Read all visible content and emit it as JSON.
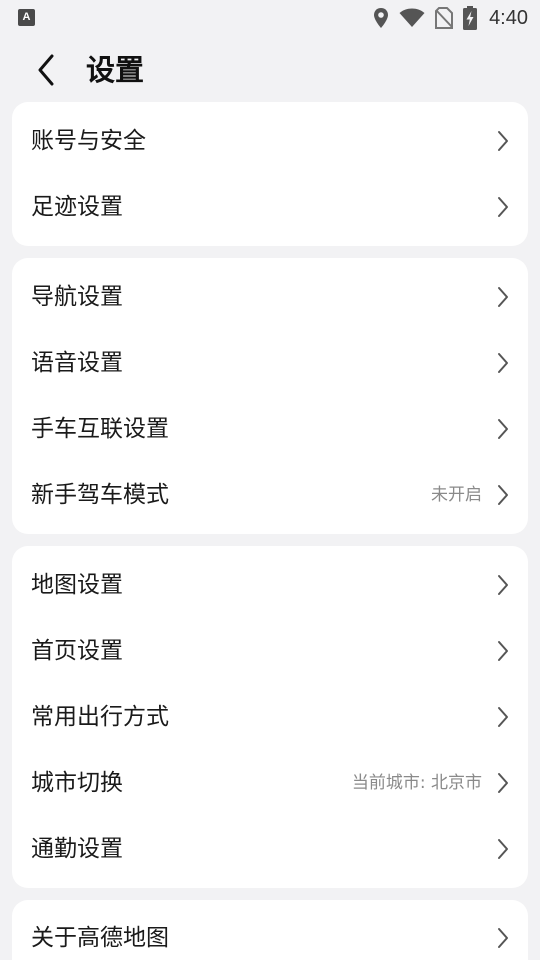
{
  "status_bar": {
    "app_badge": "A",
    "time": "4:40",
    "icons": [
      "location-icon",
      "wifi-icon",
      "no-sim-icon",
      "battery-charging-icon"
    ]
  },
  "header": {
    "back_icon": "chevron-left-icon",
    "title": "设置"
  },
  "groups": [
    {
      "items": [
        {
          "label": "账号与安全",
          "value": ""
        },
        {
          "label": "足迹设置",
          "value": ""
        }
      ]
    },
    {
      "items": [
        {
          "label": "导航设置",
          "value": ""
        },
        {
          "label": "语音设置",
          "value": ""
        },
        {
          "label": "手车互联设置",
          "value": ""
        },
        {
          "label": "新手驾车模式",
          "value": "未开启"
        }
      ]
    },
    {
      "items": [
        {
          "label": "地图设置",
          "value": ""
        },
        {
          "label": "首页设置",
          "value": ""
        },
        {
          "label": "常用出行方式",
          "value": ""
        },
        {
          "label": "城市切换",
          "value": "当前城市: 北京市"
        },
        {
          "label": "通勤设置",
          "value": ""
        }
      ]
    },
    {
      "items": [
        {
          "label": "关于高德地图",
          "value": ""
        }
      ]
    }
  ]
}
